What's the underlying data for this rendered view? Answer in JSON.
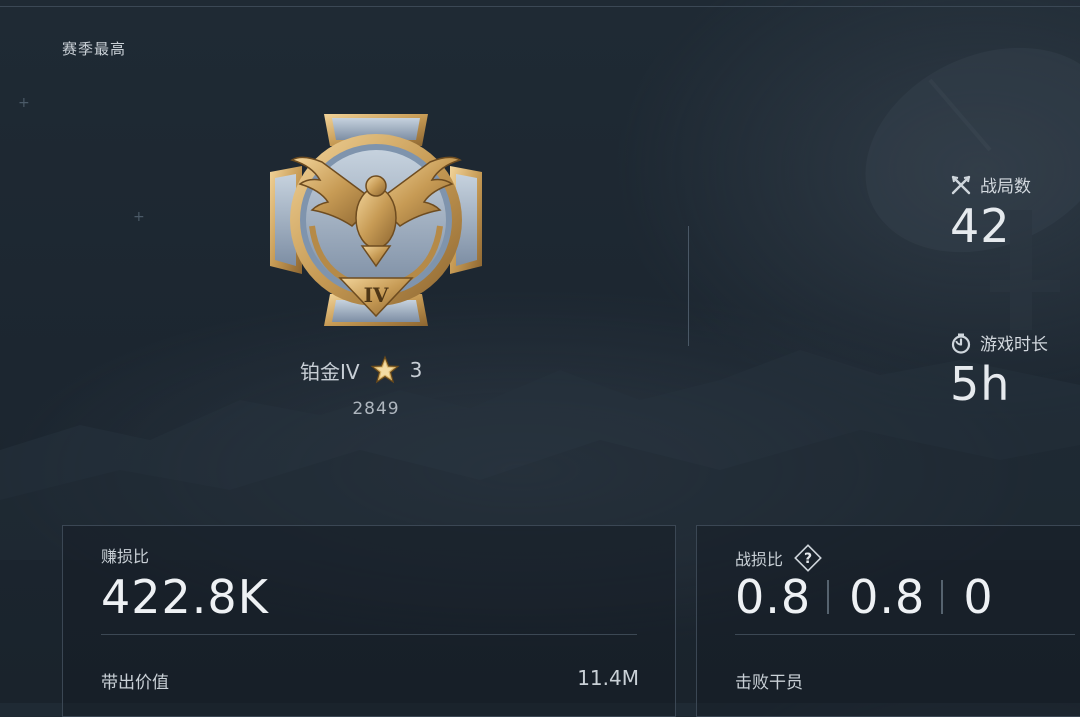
{
  "season": {
    "title": "赛季最高"
  },
  "rank": {
    "name": "铂金IV",
    "medal_numeral": "IV",
    "stars": "3",
    "score": "2849"
  },
  "stats": {
    "battles": {
      "label": "战局数",
      "value": "42",
      "icon": "crossed-swords-icon"
    },
    "play_time": {
      "label": "游戏时长",
      "value": "5h",
      "icon": "stopwatch-icon"
    }
  },
  "card_left": {
    "title": "赚损比",
    "value": "422.8K",
    "sub_label": "带出价值",
    "sub_value": "11.4M"
  },
  "card_right": {
    "title": "战损比",
    "values": [
      "0.8",
      "0.8",
      "0"
    ],
    "sub_label": "击败干员",
    "help_icon": "question-icon"
  },
  "colors": {
    "background": "#1e2832",
    "medal_gold": "#c79b55",
    "medal_silver": "#8ea0b6",
    "text": "#d7dde3"
  }
}
